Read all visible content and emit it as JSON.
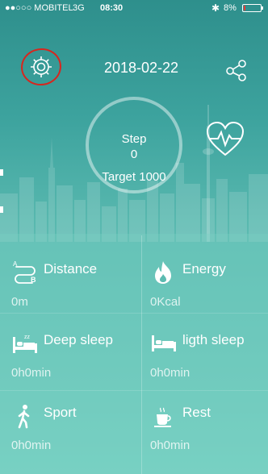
{
  "status": {
    "signal": "●●○○○",
    "carrier": "MOBITEL",
    "network": "3G",
    "time": "08:30",
    "bluetooth_icon": "bluetooth-icon",
    "battery_text": "8%",
    "battery_level": 0.08
  },
  "header": {
    "date": "2018-02-22",
    "settings_icon": "gear-icon",
    "share_icon": "share-icon"
  },
  "steps": {
    "label": "Step",
    "value": "0",
    "target_text": "Target 1000"
  },
  "heart_icon": "heart-rate-icon",
  "metrics": [
    {
      "icon": "distance-icon",
      "label": "Distance",
      "value": "0m"
    },
    {
      "icon": "flame-icon",
      "label": "Energy",
      "value": "0Kcal"
    },
    {
      "icon": "deep-sleep-bed-icon",
      "label": "Deep sleep",
      "value": "0h0min"
    },
    {
      "icon": "light-sleep-bed-icon",
      "label": "ligth sleep",
      "value": "0h0min"
    },
    {
      "icon": "walking-person-icon",
      "label": "Sport",
      "value": "0h0min"
    },
    {
      "icon": "coffee-cup-icon",
      "label": "Rest",
      "value": "0h0min"
    }
  ],
  "colors": {
    "background_top": "#2e8f8c",
    "background_bottom": "#78d0c3",
    "text": "#ffffff",
    "annotation_red": "#d7261e",
    "battery_low": "#e53935"
  }
}
